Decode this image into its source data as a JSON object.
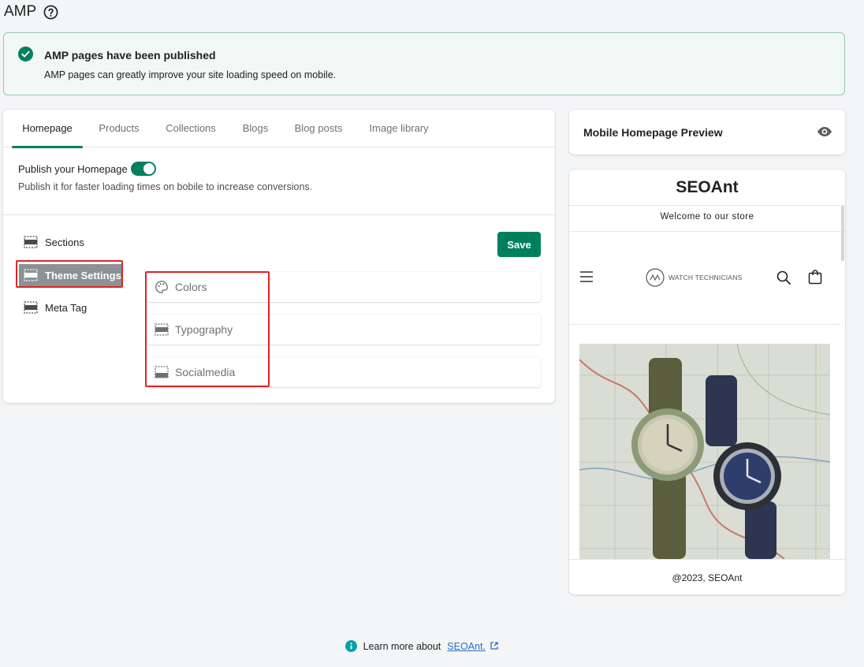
{
  "page": {
    "title": "AMP"
  },
  "banner": {
    "title": "AMP pages have been published",
    "text": "AMP pages can greatly improve your site loading speed on mobile."
  },
  "tabs": [
    {
      "label": "Homepage",
      "active": true
    },
    {
      "label": "Products"
    },
    {
      "label": "Collections"
    },
    {
      "label": "Blogs"
    },
    {
      "label": "Blog posts"
    },
    {
      "label": "Image library"
    }
  ],
  "publish": {
    "label": "Publish your Homepage",
    "enabled": true,
    "description": "Publish it for faster loading times on bobile to increase conversions."
  },
  "sidebar": {
    "items": [
      {
        "label": "Sections",
        "icon": "section-icon"
      },
      {
        "label": "Theme Settings",
        "icon": "section-icon",
        "active": true
      },
      {
        "label": "Meta Tag",
        "icon": "section-icon"
      }
    ]
  },
  "save_label": "Save",
  "theme_settings": [
    {
      "label": "Colors",
      "icon": "palette-icon"
    },
    {
      "label": "Typography",
      "icon": "section-icon"
    },
    {
      "label": "Socialmedia",
      "icon": "section-icon"
    }
  ],
  "preview": {
    "title": "Mobile Homepage Preview",
    "store_name": "SEOAnt",
    "welcome": "Welcome to our store",
    "logo_text": "WATCH TECHNICIANS",
    "copyright": "@2023, SEOAnt"
  },
  "footer": {
    "text": "Learn more about",
    "link": "SEOAnt."
  },
  "colors": {
    "accent": "#008060",
    "highlight": "#e02424"
  }
}
